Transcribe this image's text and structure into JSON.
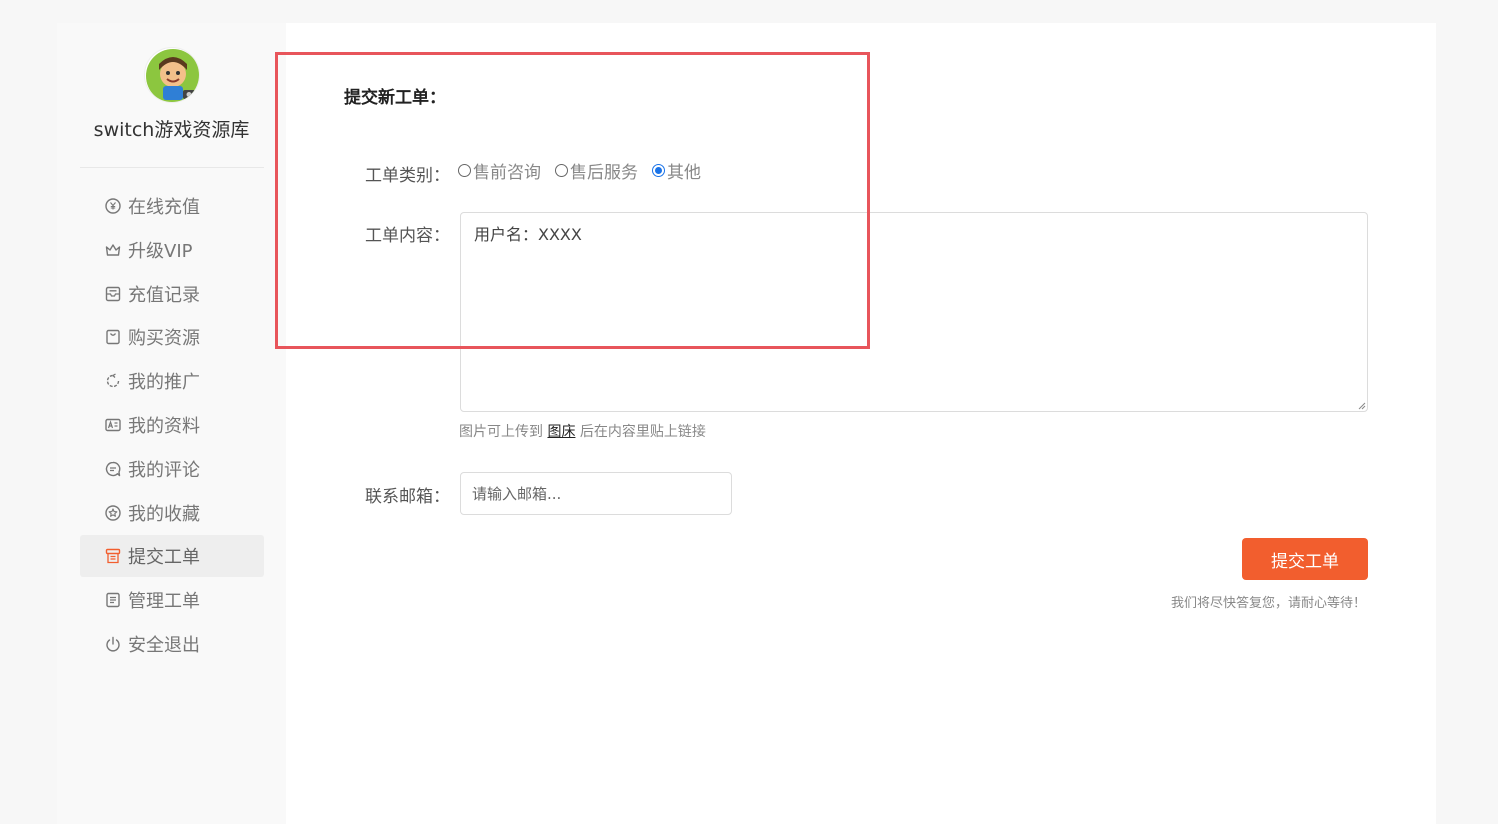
{
  "sidebar": {
    "site_name": "switch游戏资源库",
    "items": [
      {
        "label": "在线充值",
        "icon": "yen-circle-icon"
      },
      {
        "label": "升级VIP",
        "icon": "crown-icon"
      },
      {
        "label": "充值记录",
        "icon": "inbox-icon"
      },
      {
        "label": "购买资源",
        "icon": "shopping-bag-icon"
      },
      {
        "label": "我的推广",
        "icon": "loop-icon"
      },
      {
        "label": "我的资料",
        "icon": "profile-card-icon"
      },
      {
        "label": "我的评论",
        "icon": "comment-icon"
      },
      {
        "label": "我的收藏",
        "icon": "star-circle-icon"
      },
      {
        "label": "提交工单",
        "icon": "ticket-icon",
        "active": true
      },
      {
        "label": "管理工单",
        "icon": "list-doc-icon"
      },
      {
        "label": "安全退出",
        "icon": "power-icon"
      }
    ]
  },
  "form": {
    "title": "提交新工单：",
    "category_label": "工单类别：",
    "categories": [
      {
        "label": "售前咨询",
        "checked": false
      },
      {
        "label": "售后服务",
        "checked": false
      },
      {
        "label": "其他",
        "checked": true
      }
    ],
    "content_label": "工单内容：",
    "content_value": "用户名：XXXX",
    "hint_prefix": "图片可上传到",
    "hint_link": "图床",
    "hint_suffix": "后在内容里贴上链接",
    "email_label": "联系邮箱：",
    "email_placeholder": "请输入邮箱...",
    "submit_label": "提交工单",
    "note": "我们将尽快答复您，请耐心等待！"
  },
  "colors": {
    "accent": "#f25e2e",
    "highlight": "#e8555b",
    "radio": "#1a73e8"
  }
}
